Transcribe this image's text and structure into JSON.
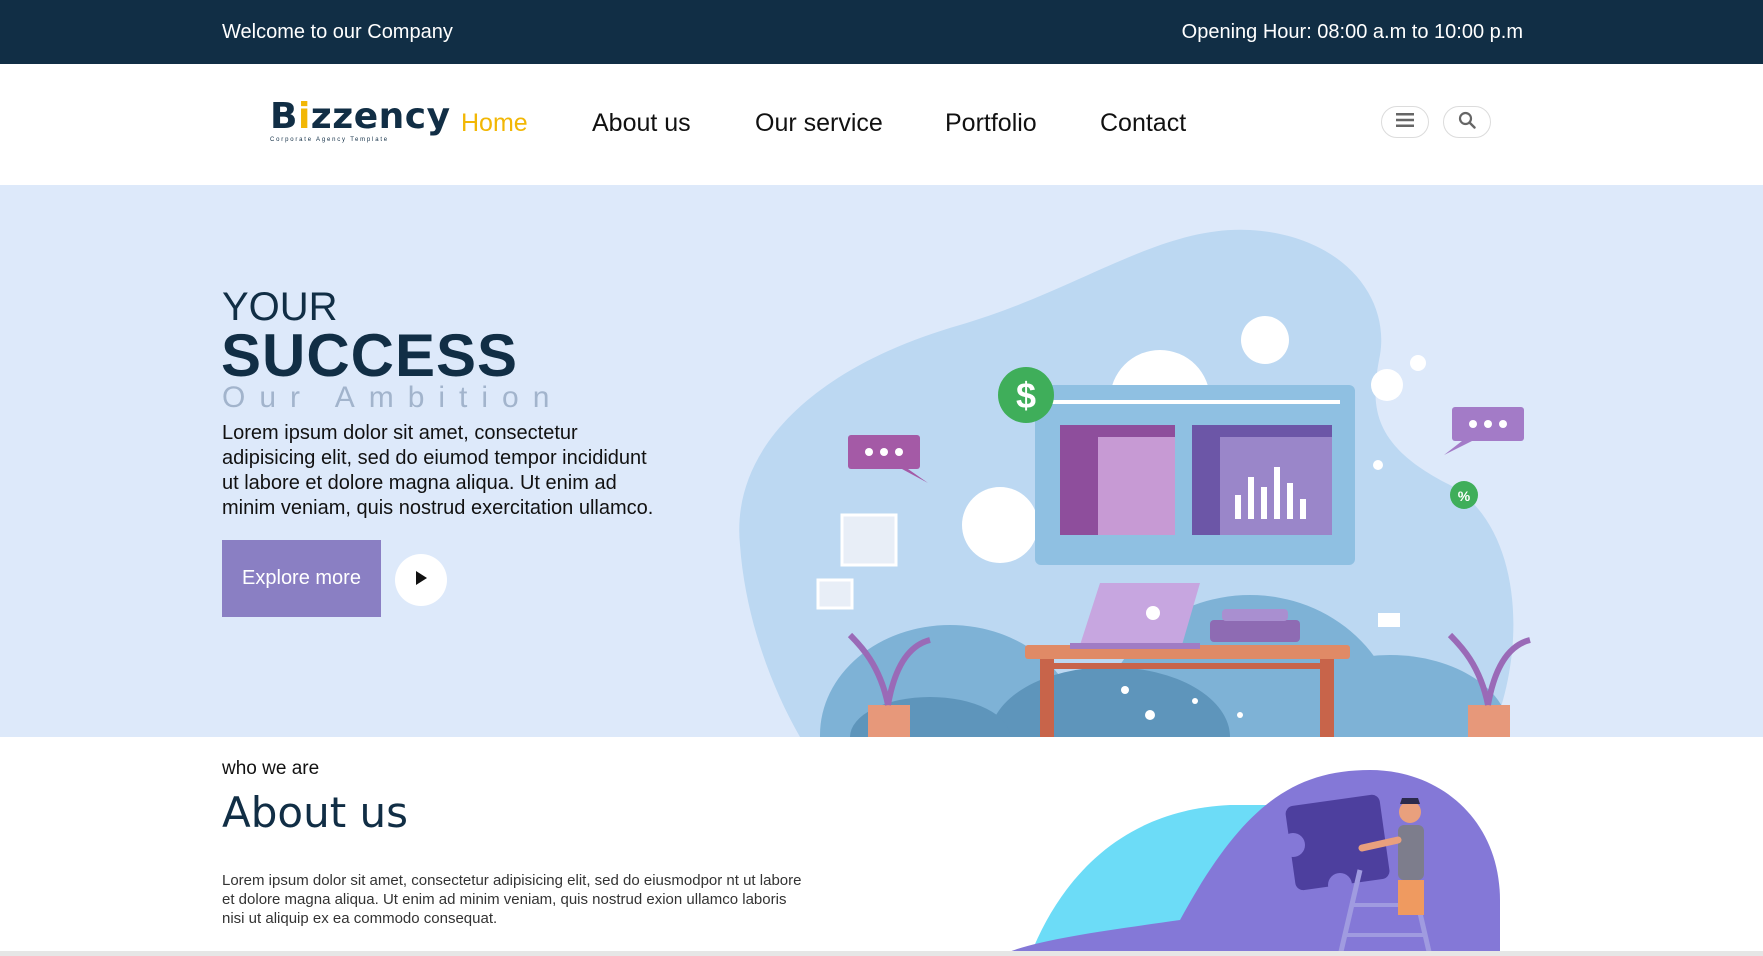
{
  "topbar": {
    "welcome": "Welcome to our Company",
    "hours": "Opening Hour: 08:00 a.m to 10:00 p.m"
  },
  "logo": {
    "name_pre": "B",
    "name_dot": "i",
    "name_post": "zzency",
    "tagline": "Corporate Agency Template"
  },
  "nav": {
    "items": [
      {
        "label": "Home",
        "active": true
      },
      {
        "label": "About us"
      },
      {
        "label": "Our service"
      },
      {
        "label": "Portfolio"
      },
      {
        "label": "Contact"
      }
    ],
    "icons": [
      "menu-icon",
      "search-icon"
    ]
  },
  "hero": {
    "line1": "YOUR",
    "line2": "SUCCESS",
    "line3": "Our Ambition",
    "description": "Lorem ipsum dolor sit amet, consectetur adipisicing elit, sed do eiumod tempor incididunt ut labore et dolore magna aliqua. Ut enim ad minim veniam, quis nostrud exercitation ullamco.",
    "cta_label": "Explore more"
  },
  "about": {
    "kicker": "who we are",
    "title": "About us",
    "description": "Lorem ipsum dolor sit amet, consectetur adipisicing elit, sed do eiusmodpor nt ut labore et dolore magna aliqua. Ut enim ad minim veniam, quis nostrud exion ullamco laboris nisi ut aliquip ex ea commodo consequat."
  },
  "colors": {
    "topbar_bg": "#112e45",
    "accent": "#f2b705",
    "hero_bg": "#dde9fa",
    "button": "#8a7fc3"
  }
}
